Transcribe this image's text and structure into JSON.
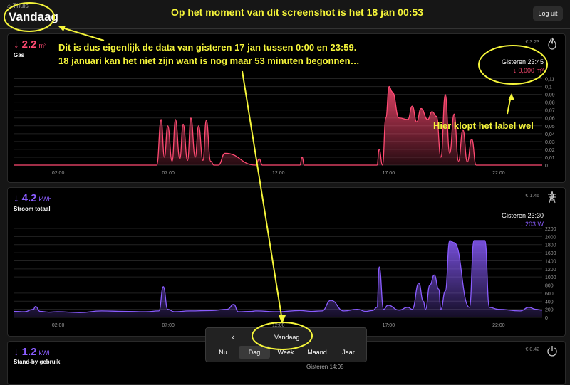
{
  "header": {
    "breadcrumb": "⌂ Thuis",
    "title": "Vandaag",
    "logout_label": "Log uit",
    "annotation": "Op het moment van dit screenshot is het 18 jan 00:53"
  },
  "gas": {
    "value": "↓ 2.2",
    "unit": "m³",
    "label": "Gas",
    "cost": "€ 3.23",
    "tooltip_time": "Gisteren 23:45",
    "tooltip_value": "↓ 0,000 m³",
    "annotation_1": "Dit is dus eigenlijk de data van gisteren 17 jan tussen 0:00 en 23:59.",
    "annotation_2": "18 januari kan het niet zijn want is nog maar 53 minuten begonnen…",
    "annotation_label": "Hier klopt het label wel",
    "x_ticks": [
      "02:00",
      "07:00",
      "12:00",
      "17:00",
      "22:00"
    ],
    "y_ticks": [
      "0,11",
      "0,1",
      "0,09",
      "0,08",
      "0,07",
      "0,06",
      "0,05",
      "0,04",
      "0,03",
      "0,02",
      "0,01",
      "0"
    ]
  },
  "power": {
    "value": "↓ 4.2",
    "unit": "kWh",
    "label": "Stroom totaal",
    "cost": "€ 1.46",
    "tooltip_time": "Gisteren 23:30",
    "tooltip_value": "↓ 203 W",
    "x_ticks": [
      "02:00",
      "07:00",
      "12:00",
      "17:00",
      "22:00"
    ],
    "y_ticks": [
      "2200",
      "2000",
      "1800",
      "1600",
      "1400",
      "1200",
      "1000",
      "800",
      "600",
      "400",
      "200",
      "0"
    ]
  },
  "standby": {
    "value": "↓ 1.2",
    "unit": "kWh",
    "label": "Stand-by gebruik",
    "cost": "€ 0.42",
    "partial_text": "Gisteren 14:05"
  },
  "period": {
    "label": "Vandaag",
    "tabs": [
      "Nu",
      "Dag",
      "Week",
      "Maand",
      "Jaar"
    ],
    "active": "Dag"
  },
  "colors": {
    "gas": "#ff4a72",
    "power": "#8a5cff",
    "annotation": "#f5f53a"
  },
  "chart_data": [
    {
      "type": "area",
      "title": "Gas",
      "x_unit": "hour",
      "ylim": [
        0,
        0.115
      ],
      "x": [
        0,
        6.5,
        6.7,
        6.85,
        7.0,
        7.2,
        7.35,
        7.55,
        7.7,
        7.9,
        8.05,
        8.25,
        8.4,
        8.6,
        8.75,
        8.95,
        9.1,
        9.3,
        9.6,
        11,
        11.15,
        11.3,
        13.0,
        13.1,
        13.2,
        16.5,
        16.6,
        16.75,
        16.9,
        17.05,
        17.2,
        17.5,
        17.9,
        18.1,
        18.3,
        18.5,
        18.8,
        19.0,
        19.2,
        19.4,
        19.6,
        19.8,
        20.0,
        20.2,
        20.4,
        20.6,
        20.8,
        21.0,
        24
      ],
      "values": [
        0,
        0,
        0.058,
        0.01,
        0.05,
        0.005,
        0.058,
        0.008,
        0.052,
        0.006,
        0.06,
        0.01,
        0.05,
        0.006,
        0.057,
        0.005,
        0,
        0,
        0.015,
        0,
        0.008,
        0,
        0,
        0.01,
        0,
        0,
        0.02,
        0,
        0.06,
        0.1,
        0.093,
        0.06,
        0.058,
        0.075,
        0.055,
        0.072,
        0.058,
        0.068,
        0.062,
        0.01,
        0.09,
        0.015,
        0.065,
        0.005,
        0.045,
        0.004,
        0.033,
        0,
        0
      ]
    },
    {
      "type": "area",
      "title": "Stroom totaal",
      "x_unit": "hour",
      "ylim": [
        0,
        2200
      ],
      "x": [
        0,
        0.5,
        0.9,
        1.0,
        1.2,
        1.6,
        2.0,
        3.0,
        4.0,
        5.0,
        6.0,
        6.6,
        6.8,
        7.0,
        7.3,
        8.0,
        9.0,
        9.7,
        10.0,
        10.2,
        10.8,
        11.0,
        12.0,
        13.0,
        13.5,
        14.0,
        14.4,
        15.0,
        15.6,
        16.0,
        16.3,
        16.5,
        16.6,
        16.8,
        17.0,
        17.5,
        17.9,
        18.1,
        18.4,
        18.6,
        18.7,
        18.9,
        19.1,
        19.3,
        19.4,
        19.6,
        19.8,
        20.0,
        20.7,
        20.9,
        21.4,
        21.6,
        22.0,
        23.0,
        23.4,
        23.7,
        24
      ],
      "values": [
        150,
        140,
        200,
        270,
        150,
        130,
        140,
        120,
        160,
        150,
        140,
        160,
        760,
        200,
        140,
        160,
        170,
        200,
        320,
        140,
        150,
        160,
        140,
        170,
        150,
        160,
        420,
        160,
        200,
        150,
        170,
        250,
        1250,
        200,
        300,
        180,
        250,
        200,
        850,
        400,
        200,
        800,
        1050,
        700,
        200,
        650,
        1900,
        1850,
        250,
        1900,
        1900,
        250,
        200,
        160,
        250,
        200,
        180
      ]
    }
  ]
}
